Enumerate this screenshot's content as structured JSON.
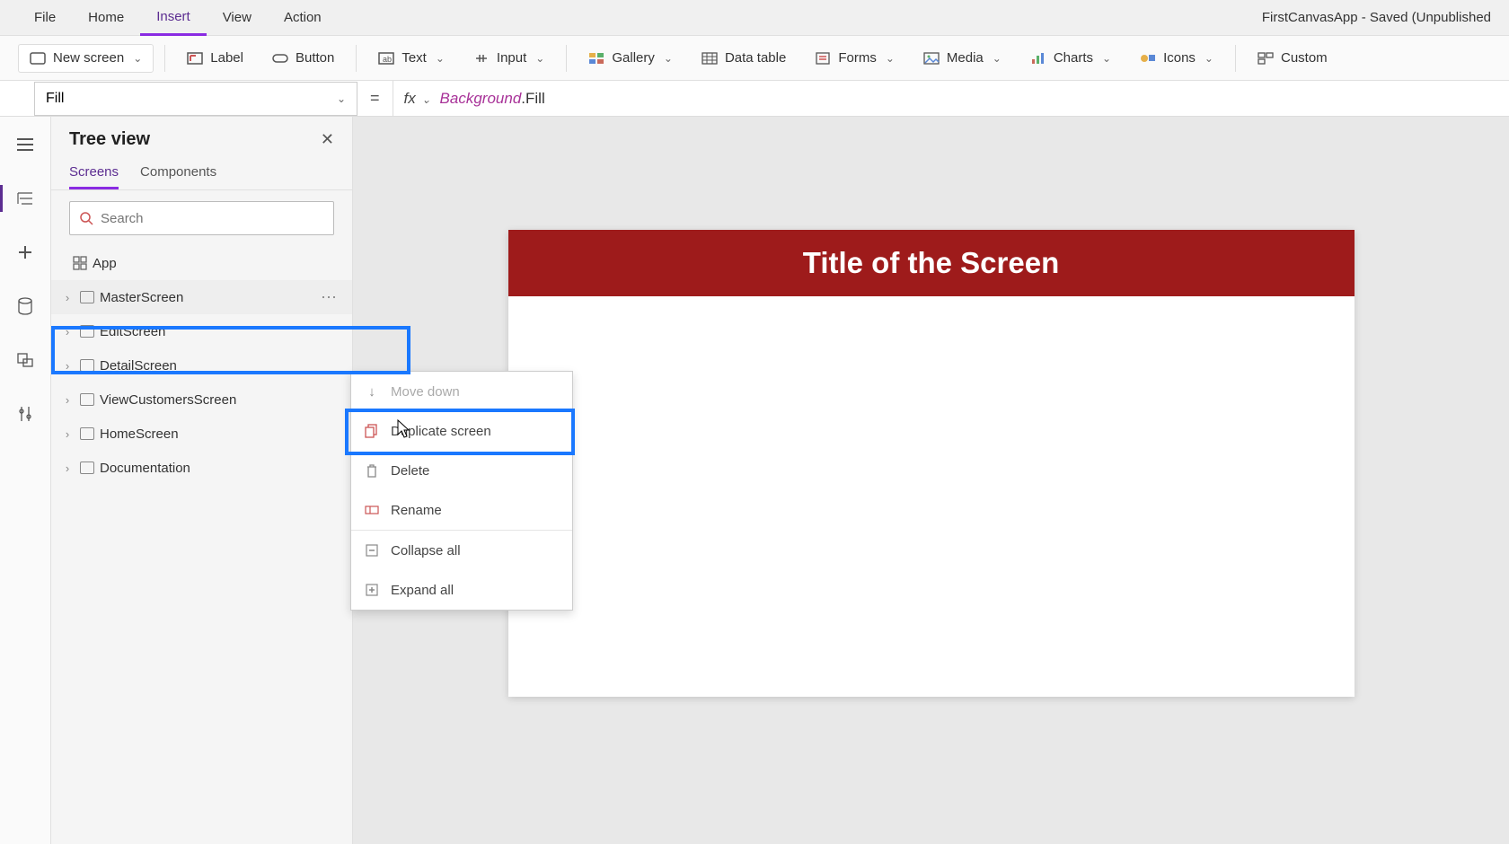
{
  "menu": {
    "file": "File",
    "home": "Home",
    "insert": "Insert",
    "view": "View",
    "action": "Action",
    "active": "Insert"
  },
  "appTitle": "FirstCanvasApp - Saved (Unpublished",
  "ribbon": {
    "newScreen": "New screen",
    "label": "Label",
    "button": "Button",
    "text": "Text",
    "input": "Input",
    "gallery": "Gallery",
    "dataTable": "Data table",
    "forms": "Forms",
    "media": "Media",
    "charts": "Charts",
    "icons": "Icons",
    "custom": "Custom"
  },
  "formula": {
    "property": "Fill",
    "fx": "fx",
    "part1": "Background",
    "part2": ".Fill"
  },
  "tree": {
    "title": "Tree view",
    "tabs": {
      "screens": "Screens",
      "components": "Components"
    },
    "searchPlaceholder": "Search",
    "app": "App",
    "items": [
      {
        "label": "MasterScreen"
      },
      {
        "label": "EditScreen"
      },
      {
        "label": "DetailScreen"
      },
      {
        "label": "ViewCustomersScreen"
      },
      {
        "label": "HomeScreen"
      },
      {
        "label": "Documentation"
      }
    ]
  },
  "ctx": {
    "moveDown": "Move down",
    "duplicate": "Duplicate screen",
    "delete": "Delete",
    "rename": "Rename",
    "collapse": "Collapse all",
    "expand": "Expand all"
  },
  "canvas": {
    "title": "Title of the Screen"
  },
  "colors": {
    "accent": "#8a2be2",
    "headerRed": "#9e1b1b",
    "highlight": "#1a78ff"
  }
}
